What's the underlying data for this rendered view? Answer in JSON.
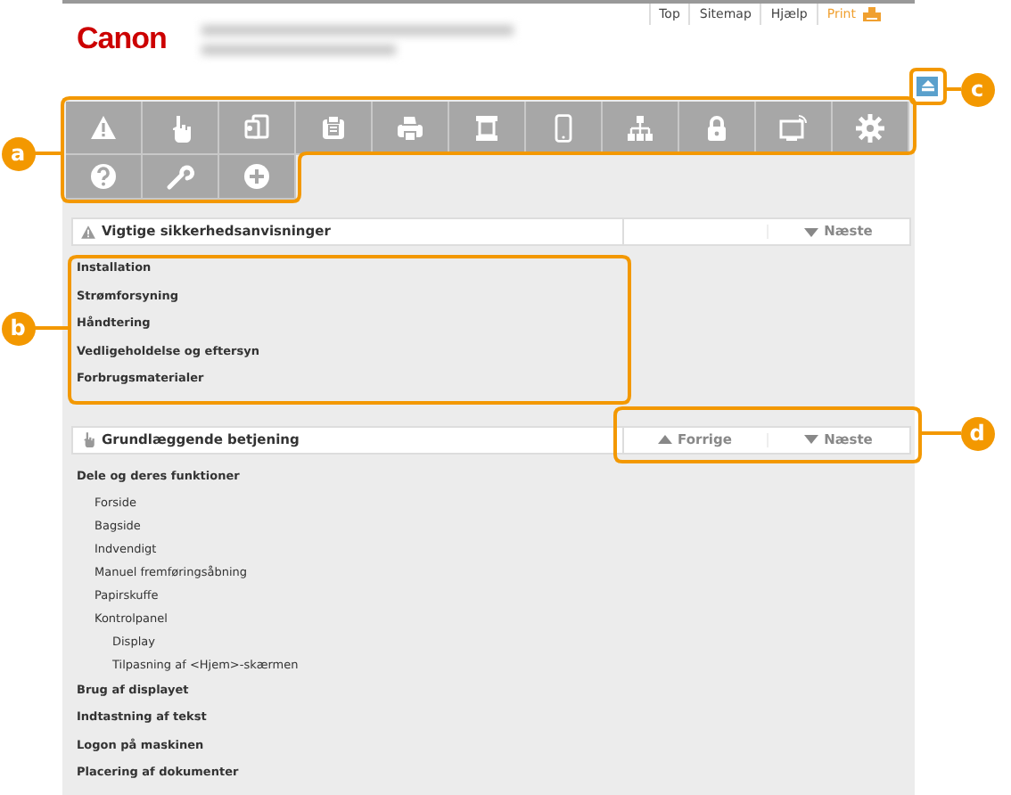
{
  "header": {
    "logo": "Canon",
    "links": [
      {
        "label": "Top",
        "kind": "plain"
      },
      {
        "label": "Sitemap",
        "kind": "plain"
      },
      {
        "label": "Hjælp",
        "kind": "plain"
      },
      {
        "label": "Print",
        "kind": "print"
      }
    ]
  },
  "toolbar": [
    {
      "kind": "warning"
    },
    {
      "kind": "hand"
    },
    {
      "kind": "copy"
    },
    {
      "kind": "fax"
    },
    {
      "kind": "printer"
    },
    {
      "kind": "scanner"
    },
    {
      "kind": "phone"
    },
    {
      "kind": "network"
    },
    {
      "kind": "lock"
    },
    {
      "kind": "monitor"
    },
    {
      "kind": "gear"
    },
    {
      "kind": "help"
    },
    {
      "kind": "wrench"
    },
    {
      "kind": "plus"
    }
  ],
  "sections": [
    {
      "title": "Vigtige sikkerhedsanvisninger",
      "kind": "warning",
      "nav": [
        {
          "label": "Næste",
          "kind": "next"
        }
      ],
      "items": [
        {
          "label": "Installation"
        },
        {
          "label": "Strømforsyning"
        },
        {
          "label": "Håndtering"
        },
        {
          "label": "Vedligeholdelse og eftersyn"
        },
        {
          "label": "Forbrugsmaterialer"
        }
      ]
    },
    {
      "title": "Grundlæggende betjening",
      "kind": "hand",
      "nav": [
        {
          "label": "Forrige",
          "kind": "previous"
        },
        {
          "label": "Næste",
          "kind": "next"
        }
      ],
      "items": [
        {
          "label": "Dele og deres funktioner",
          "children": [
            {
              "label": "Forside"
            },
            {
              "label": "Bagside"
            },
            {
              "label": "Indvendigt"
            },
            {
              "label": "Manuel fremføringsåbning"
            },
            {
              "label": "Papirskuffe"
            },
            {
              "label": "Kontrolpanel",
              "children": [
                {
                  "label": "Display"
                },
                {
                  "label": "Tilpasning af <Hjem>-skærmen"
                }
              ]
            }
          ]
        },
        {
          "label": "Brug af displayet"
        },
        {
          "label": "Indtastning af tekst"
        },
        {
          "label": "Logon på maskinen"
        },
        {
          "label": "Placering af dokumenter"
        }
      ]
    }
  ],
  "callouts": [
    {
      "label": "a"
    },
    {
      "label": "b"
    },
    {
      "label": "c"
    },
    {
      "label": "d"
    }
  ]
}
